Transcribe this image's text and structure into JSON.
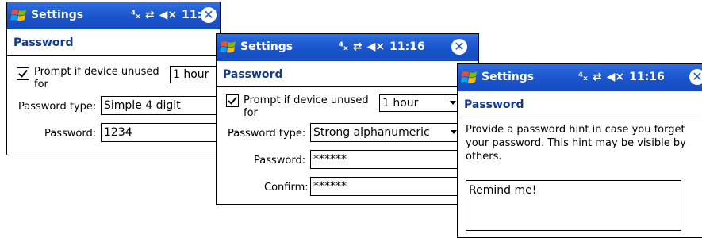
{
  "status": {
    "signal": "⁴ₓ",
    "sync": "⇄",
    "volume": "◀×",
    "time": "11:16",
    "close": "✕"
  },
  "window1": {
    "title": "Settings",
    "page_title": "Password",
    "prompt_label_line1": "Prompt if device unused",
    "prompt_label_line2": "for",
    "prompt_value": "1 hour",
    "password_type_label": "Password type:",
    "password_type_value": "Simple 4 digit",
    "password_label": "Password:",
    "password_value": "1234"
  },
  "window2": {
    "title": "Settings",
    "page_title": "Password",
    "prompt_label_line1": "Prompt if device unused",
    "prompt_label_line2": "for",
    "prompt_value": "1 hour",
    "password_type_label": "Password type:",
    "password_type_value": "Strong alphanumeric",
    "password_label": "Password:",
    "password_value": "******",
    "confirm_label": "Confirm:",
    "confirm_value": "******"
  },
  "window3": {
    "title": "Settings",
    "page_title": "Password",
    "hint_text_line1": "Provide a password hint in case you forget",
    "hint_text_line2": "your password.  This hint may be visible by",
    "hint_text_line3": "others.",
    "hint_value": "Remind me!"
  }
}
